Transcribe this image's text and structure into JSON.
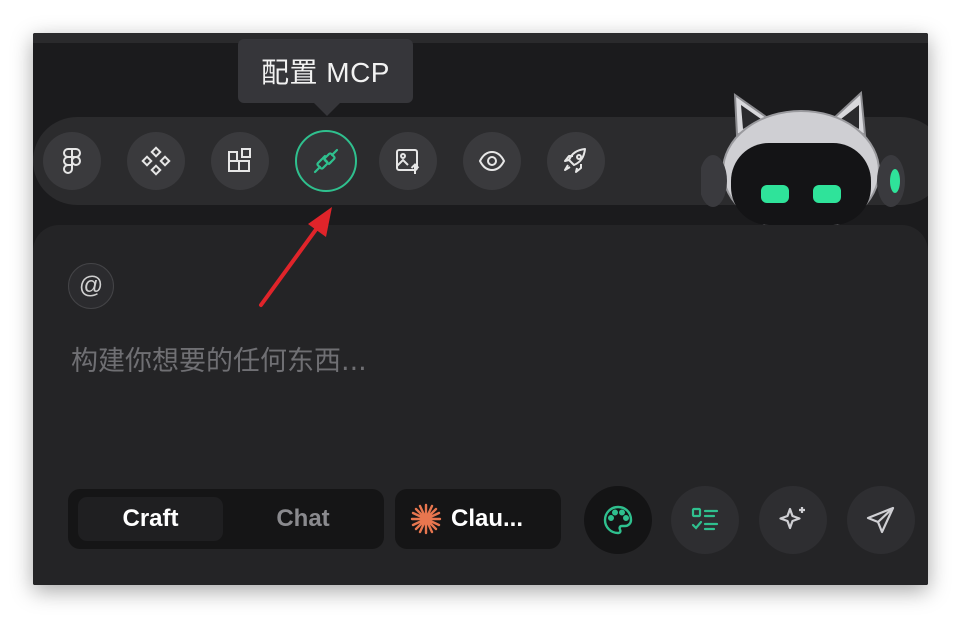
{
  "tooltip": {
    "text": "配置 MCP"
  },
  "toolbar": {
    "items": [
      {
        "icon": "figma-icon",
        "active": false
      },
      {
        "icon": "components-icon",
        "active": false
      },
      {
        "icon": "widgets-icon",
        "active": false
      },
      {
        "icon": "plug-icon",
        "active": true
      },
      {
        "icon": "image-upload-icon",
        "active": false
      },
      {
        "icon": "eye-icon",
        "active": false
      },
      {
        "icon": "rocket-icon",
        "active": false
      }
    ]
  },
  "input": {
    "mention_symbol": "@",
    "placeholder": "构建你想要的任何东西..."
  },
  "mode": {
    "options": [
      "Craft",
      "Chat"
    ],
    "selected": "Craft"
  },
  "model": {
    "label": "Clau...",
    "icon": "claude-sparkle-icon"
  },
  "actions": [
    "palette-icon",
    "checklist-icon",
    "sparkle-icon",
    "send-icon"
  ],
  "colors": {
    "accent": "#2fc08e",
    "annotation_arrow": "#e0242a",
    "claude_orange": "#e8764f"
  }
}
